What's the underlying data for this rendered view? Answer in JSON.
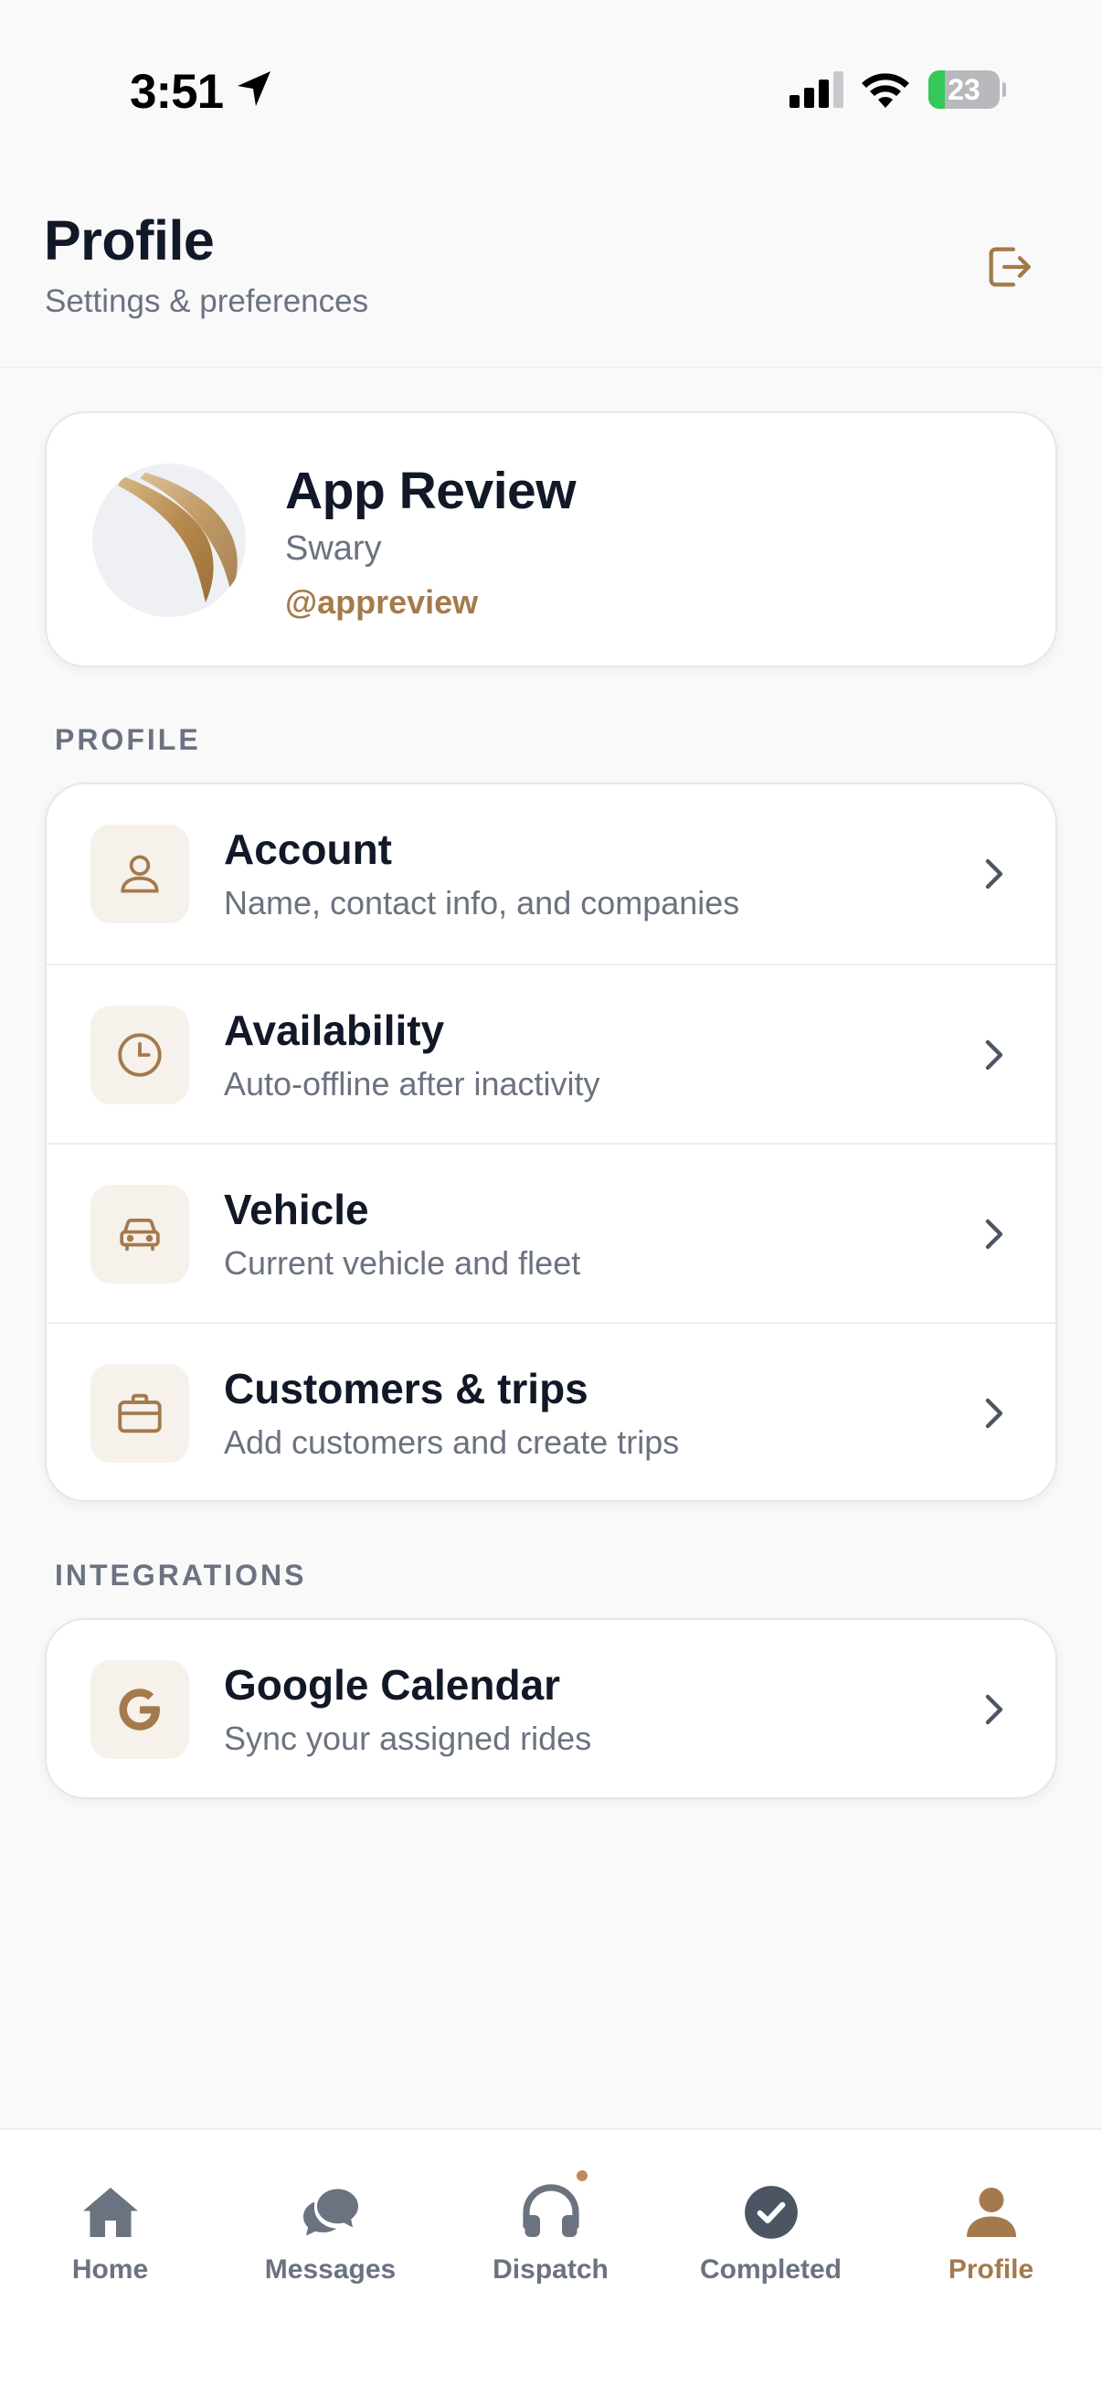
{
  "status_bar": {
    "time": "3:51",
    "battery": "23",
    "battery_level": 0.23
  },
  "header": {
    "title": "Profile",
    "subtitle": "Settings & preferences",
    "logout_icon": "logout-icon"
  },
  "profile_card": {
    "name": "App Review",
    "company": "Swary",
    "handle": "@appreview"
  },
  "sections": {
    "profile_label": "PROFILE",
    "integrations_label": "INTEGRATIONS"
  },
  "profile_items": [
    {
      "title": "Account",
      "subtitle": "Name, contact info, and companies",
      "icon": "person-icon"
    },
    {
      "title": "Availability",
      "subtitle": "Auto-offline after inactivity",
      "icon": "clock-icon"
    },
    {
      "title": "Vehicle",
      "subtitle": "Current vehicle and fleet",
      "icon": "car-icon"
    },
    {
      "title": "Customers & trips",
      "subtitle": "Add customers and create trips",
      "icon": "briefcase-icon"
    }
  ],
  "integration_items": [
    {
      "title": "Google Calendar",
      "subtitle": "Sync your assigned rides",
      "icon": "google-icon"
    }
  ],
  "tabs": [
    {
      "label": "Home",
      "icon": "home-icon"
    },
    {
      "label": "Messages",
      "icon": "messages-icon"
    },
    {
      "label": "Dispatch",
      "icon": "headphones-icon"
    },
    {
      "label": "Completed",
      "icon": "check-circle-icon"
    },
    {
      "label": "Profile",
      "icon": "person-icon",
      "active": true
    }
  ],
  "colors": {
    "accent": "#a47a4c",
    "icon_bg": "#f6f1eb",
    "text_primary": "#111827",
    "text_secondary": "#6b7280"
  }
}
